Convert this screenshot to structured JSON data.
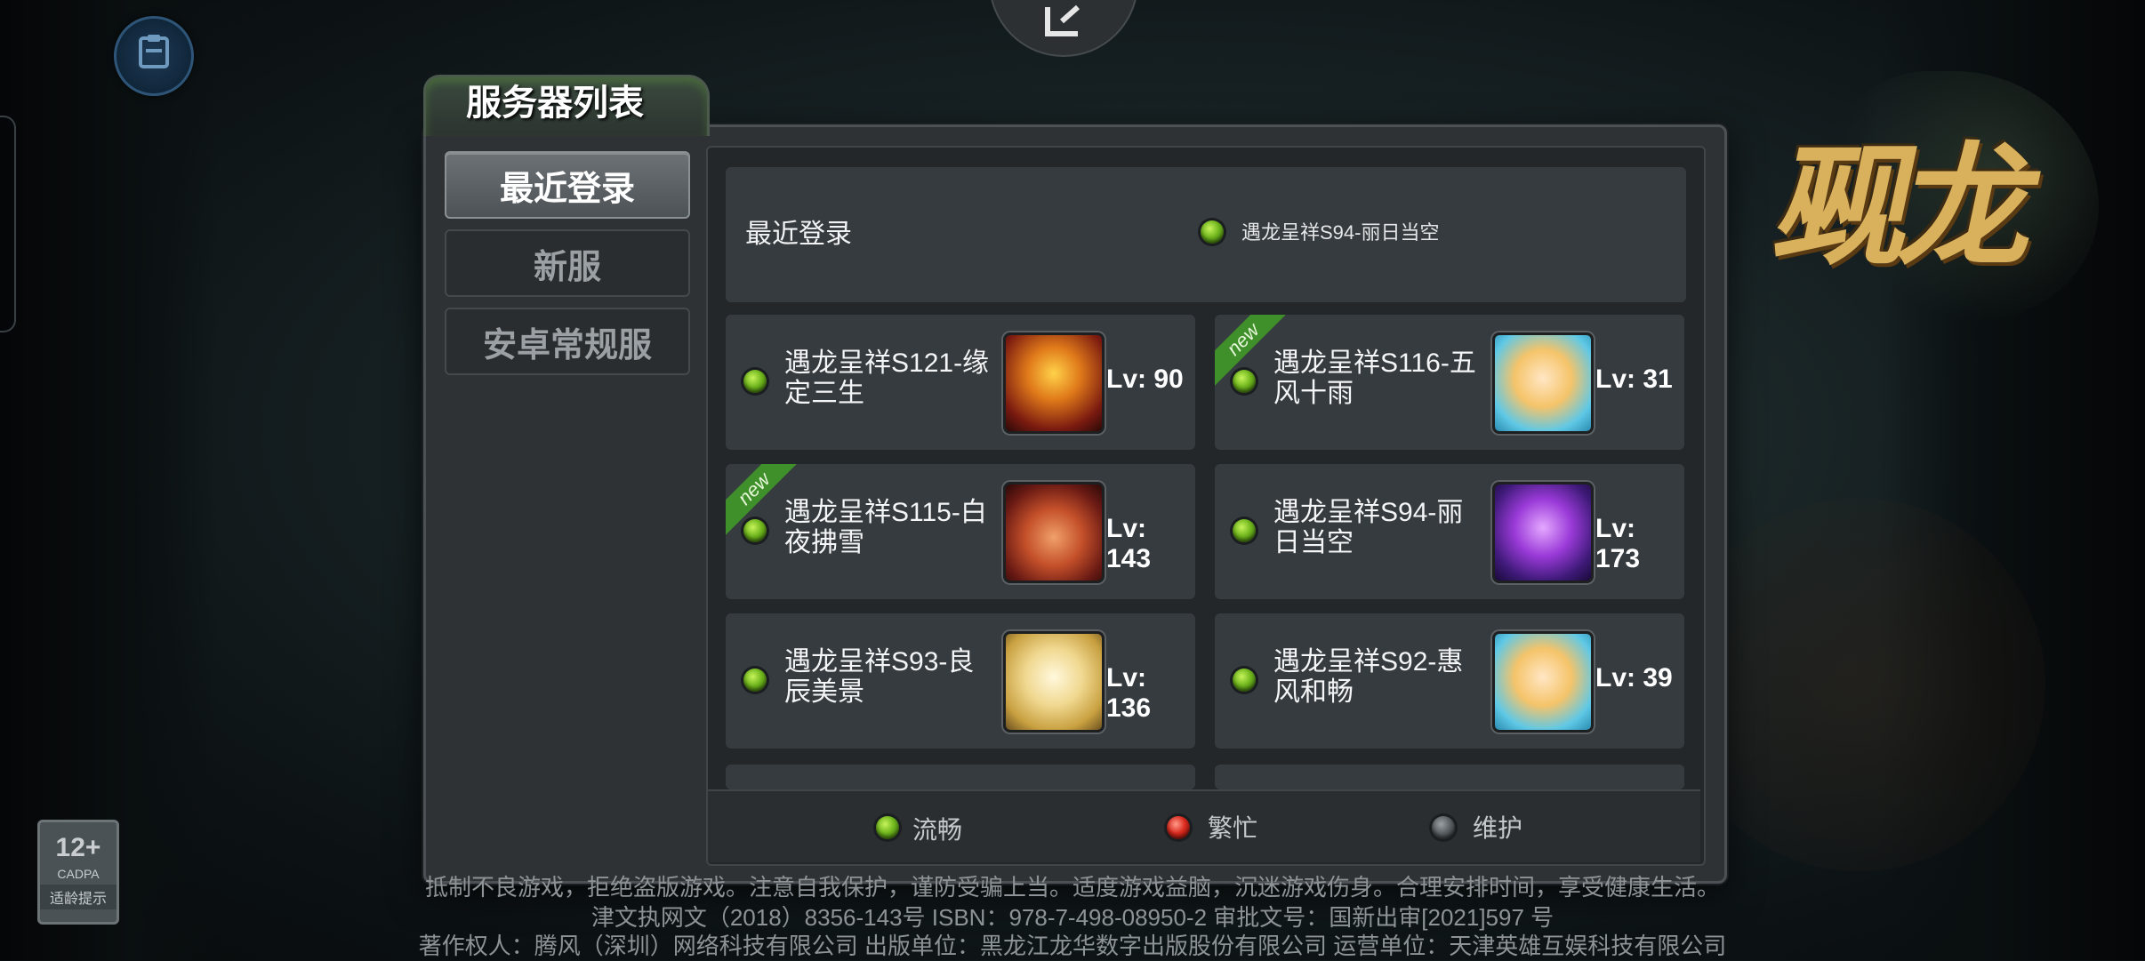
{
  "dialog": {
    "title": "服务器列表"
  },
  "tabs": [
    {
      "label": "最近登录",
      "active": true
    },
    {
      "label": "新服",
      "active": false
    },
    {
      "label": "安卓常规服",
      "active": false
    }
  ],
  "recent": {
    "label": "最近登录",
    "server": "遇龙呈祥S94-丽日当空",
    "status": "green"
  },
  "servers": [
    {
      "name": "遇龙呈祥S121-缘定三生",
      "level": "Lv: 90",
      "is_new": false,
      "status": "green",
      "avatar": "dragon-hero-avatar"
    },
    {
      "name": "遇龙呈祥S116-五风十雨",
      "level": "Lv: 31",
      "is_new": true,
      "status": "green",
      "avatar": "elf-girl-avatar"
    },
    {
      "name": "遇龙呈祥S115-白夜拂雪",
      "level": "Lv: 143",
      "is_new": true,
      "status": "green",
      "avatar": "horned-beast-avatar"
    },
    {
      "name": "遇龙呈祥S94-丽日当空",
      "level": "Lv: 173",
      "is_new": false,
      "status": "green",
      "avatar": "purple-dragon-avatar"
    },
    {
      "name": "遇龙呈祥S93-良辰美景",
      "level": "Lv: 136",
      "is_new": false,
      "status": "green",
      "avatar": "golden-dragon-avatar"
    },
    {
      "name": "遇龙呈祥S92-惠风和畅",
      "level": "Lv: 39",
      "is_new": false,
      "status": "green",
      "avatar": "elf-girl-avatar"
    }
  ],
  "new_badge": "new",
  "legend": [
    {
      "label": "流畅",
      "status": "green"
    },
    {
      "label": "繁忙",
      "status": "red"
    },
    {
      "label": "维护",
      "status": "gray"
    }
  ],
  "footer": {
    "line1": "抵制不良游戏，拒绝盗版游戏。注意自我保护，谨防受骗上当。适度游戏益脑，沉迷游戏伤身。合理安排时间，享受健康生活。",
    "line2": "津文执网文（2018）8356-143号 ISBN：978-7-498-08950-2 审批文号：国新出审[2021]597 号",
    "line3": "著作权人：腾风（深圳）网络科技有限公司 出版单位：黑龙江龙华数字出版股份有限公司 运营单位：天津英雄互娱科技有限公司"
  },
  "age_rating": {
    "age": "12+",
    "org": "CADPA",
    "tip": "适龄提示"
  },
  "logo_text": "觋龙",
  "colors": {
    "status_green": "#6fb51d",
    "status_red": "#d92a1d",
    "status_gray": "#5b6064",
    "new_ribbon": "#3f8f2a"
  }
}
